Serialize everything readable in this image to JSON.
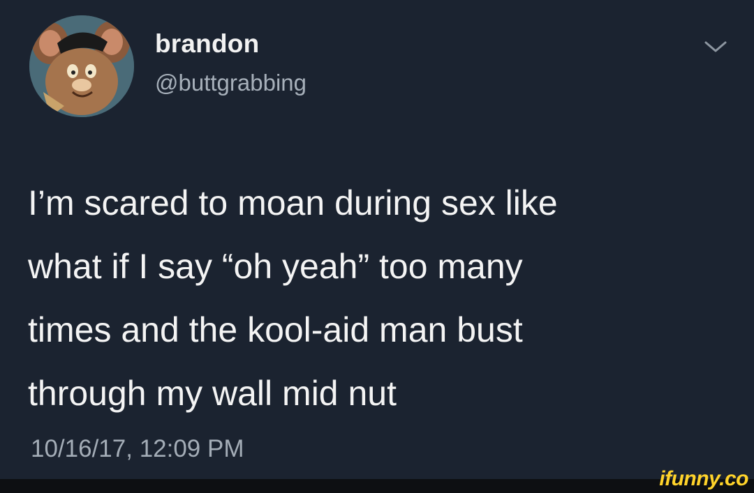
{
  "tweet": {
    "display_name": "brandon",
    "handle": "@buttgrabbing",
    "text": "I’m scared to moan during sex like\nwhat if I say “oh yeah” too many\ntimes and the kool-aid man bust\nthrough my wall mid nut",
    "timestamp": "10/16/17, 12:09 PM",
    "menu_icon": "chevron-down-icon",
    "avatar_icon": "cartoon-mouse-avatar"
  },
  "watermark": {
    "text": "ifunny.co"
  },
  "colors": {
    "background": "#1b2330",
    "primary_text": "#f4f4f4",
    "secondary_text": "#a7b0ba",
    "watermark": "#ffd32a"
  }
}
